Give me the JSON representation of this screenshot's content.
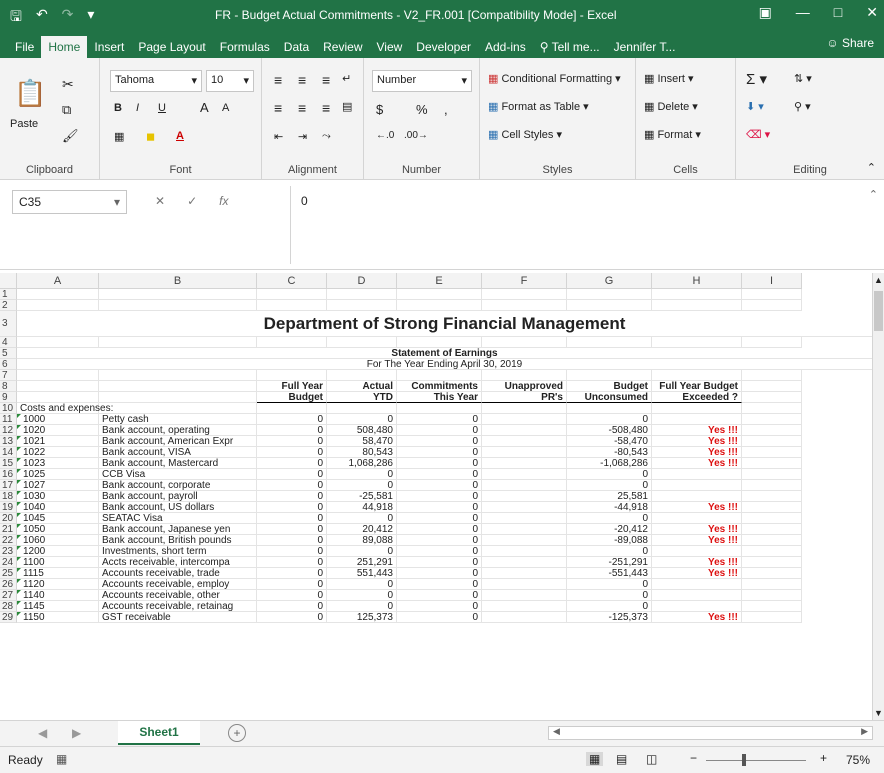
{
  "window": {
    "title": "FR - Budget Actual Commitments - V2_FR.001  [Compatibility Mode] - Excel",
    "qat": {
      "save_icon": "save-icon",
      "undo_icon": "undo-icon",
      "redo_icon": "redo-icon"
    }
  },
  "menu": {
    "tabs": [
      "File",
      "Home",
      "Insert",
      "Page Layout",
      "Formulas",
      "Data",
      "Review",
      "View",
      "Developer",
      "Add-ins"
    ],
    "tell_me": "Tell me...",
    "user": "Jennifer T...",
    "share": "Share"
  },
  "ribbon": {
    "clipboard": {
      "label": "Clipboard",
      "paste": "Paste"
    },
    "font": {
      "label": "Font",
      "family": "Tahoma",
      "size": "10",
      "bold": "B",
      "italic": "I",
      "underline": "U",
      "grow": "A",
      "shrink": "A"
    },
    "alignment": {
      "label": "Alignment"
    },
    "number": {
      "label": "Number",
      "format": "Number",
      "currency": "$",
      "percent": "%",
      "comma": ","
    },
    "styles": {
      "label": "Styles",
      "conditional": "Conditional Formatting",
      "table": "Format as Table",
      "cell_styles": "Cell Styles"
    },
    "cells": {
      "label": "Cells",
      "insert": "Insert",
      "delete": "Delete",
      "format": "Format"
    },
    "editing": {
      "label": "Editing"
    }
  },
  "formula": {
    "namebox": "C35",
    "value": "0"
  },
  "columns": [
    "A",
    "B",
    "C",
    "D",
    "E",
    "F",
    "G",
    "H",
    "I"
  ],
  "sheet": {
    "title": "Department of Strong Financial Management",
    "subtitle": "Statement of Earnings",
    "period": "For The Year Ending April 30, 2019",
    "header1": [
      "",
      "",
      "Full Year",
      "Actual",
      "Commitments",
      "Unapproved",
      "Budget",
      "Full Year Budget",
      ""
    ],
    "header2": [
      "",
      "",
      "Budget",
      "YTD",
      "This Year",
      "PR's",
      "Unconsumed",
      "Exceeded ?",
      ""
    ],
    "section": "Costs and expenses:",
    "rows": [
      {
        "r": "11",
        "a": "1000",
        "b": "Petty cash",
        "c": "0",
        "d": "0",
        "e": "0",
        "f": "",
        "g": "0",
        "h": ""
      },
      {
        "r": "12",
        "a": "1020",
        "b": "Bank account, operating",
        "c": "0",
        "d": "508,480",
        "e": "0",
        "f": "",
        "g": "-508,480",
        "h": "Yes !!!"
      },
      {
        "r": "13",
        "a": "1021",
        "b": "Bank account, American Expr",
        "c": "0",
        "d": "58,470",
        "e": "0",
        "f": "",
        "g": "-58,470",
        "h": "Yes !!!"
      },
      {
        "r": "14",
        "a": "1022",
        "b": "Bank account, VISA",
        "c": "0",
        "d": "80,543",
        "e": "0",
        "f": "",
        "g": "-80,543",
        "h": "Yes !!!"
      },
      {
        "r": "15",
        "a": "1023",
        "b": "Bank account, Mastercard",
        "c": "0",
        "d": "1,068,286",
        "e": "0",
        "f": "",
        "g": "-1,068,286",
        "h": "Yes !!!"
      },
      {
        "r": "16",
        "a": "1025",
        "b": "CCB Visa",
        "c": "0",
        "d": "0",
        "e": "0",
        "f": "",
        "g": "0",
        "h": ""
      },
      {
        "r": "17",
        "a": "1027",
        "b": "Bank account, corporate",
        "c": "0",
        "d": "0",
        "e": "0",
        "f": "",
        "g": "0",
        "h": ""
      },
      {
        "r": "18",
        "a": "1030",
        "b": "Bank account, payroll",
        "c": "0",
        "d": "-25,581",
        "e": "0",
        "f": "",
        "g": "25,581",
        "h": ""
      },
      {
        "r": "19",
        "a": "1040",
        "b": "Bank account, US dollars",
        "c": "0",
        "d": "44,918",
        "e": "0",
        "f": "",
        "g": "-44,918",
        "h": "Yes !!!"
      },
      {
        "r": "20",
        "a": "1045",
        "b": "SEATAC Visa",
        "c": "0",
        "d": "0",
        "e": "0",
        "f": "",
        "g": "0",
        "h": ""
      },
      {
        "r": "21",
        "a": "1050",
        "b": "Bank account, Japanese yen",
        "c": "0",
        "d": "20,412",
        "e": "0",
        "f": "",
        "g": "-20,412",
        "h": "Yes !!!"
      },
      {
        "r": "22",
        "a": "1060",
        "b": "Bank account, British pounds",
        "c": "0",
        "d": "89,088",
        "e": "0",
        "f": "",
        "g": "-89,088",
        "h": "Yes !!!"
      },
      {
        "r": "23",
        "a": "1200",
        "b": "Investments, short term",
        "c": "0",
        "d": "0",
        "e": "0",
        "f": "",
        "g": "0",
        "h": ""
      },
      {
        "r": "24",
        "a": "1100",
        "b": "Accts receivable, intercompa",
        "c": "0",
        "d": "251,291",
        "e": "0",
        "f": "",
        "g": "-251,291",
        "h": "Yes !!!"
      },
      {
        "r": "25",
        "a": "1115",
        "b": "Accounts receivable, trade",
        "c": "0",
        "d": "551,443",
        "e": "0",
        "f": "",
        "g": "-551,443",
        "h": "Yes !!!"
      },
      {
        "r": "26",
        "a": "1120",
        "b": "Accounts receivable, employ",
        "c": "0",
        "d": "0",
        "e": "0",
        "f": "",
        "g": "0",
        "h": ""
      },
      {
        "r": "27",
        "a": "1140",
        "b": "Accounts receivable, other",
        "c": "0",
        "d": "0",
        "e": "0",
        "f": "",
        "g": "0",
        "h": ""
      },
      {
        "r": "28",
        "a": "1145",
        "b": "Accounts receivable, retainag",
        "c": "0",
        "d": "0",
        "e": "0",
        "f": "",
        "g": "0",
        "h": ""
      },
      {
        "r": "29",
        "a": "1150",
        "b": "GST receivable",
        "c": "0",
        "d": "125,373",
        "e": "0",
        "f": "",
        "g": "-125,373",
        "h": "Yes !!!"
      }
    ]
  },
  "sheet_tabs": {
    "active": "Sheet1",
    "add": "+"
  },
  "status": {
    "ready": "Ready",
    "zoom": "75%"
  },
  "colors": {
    "excel_green": "#217346",
    "alert_red": "#dd1111"
  }
}
